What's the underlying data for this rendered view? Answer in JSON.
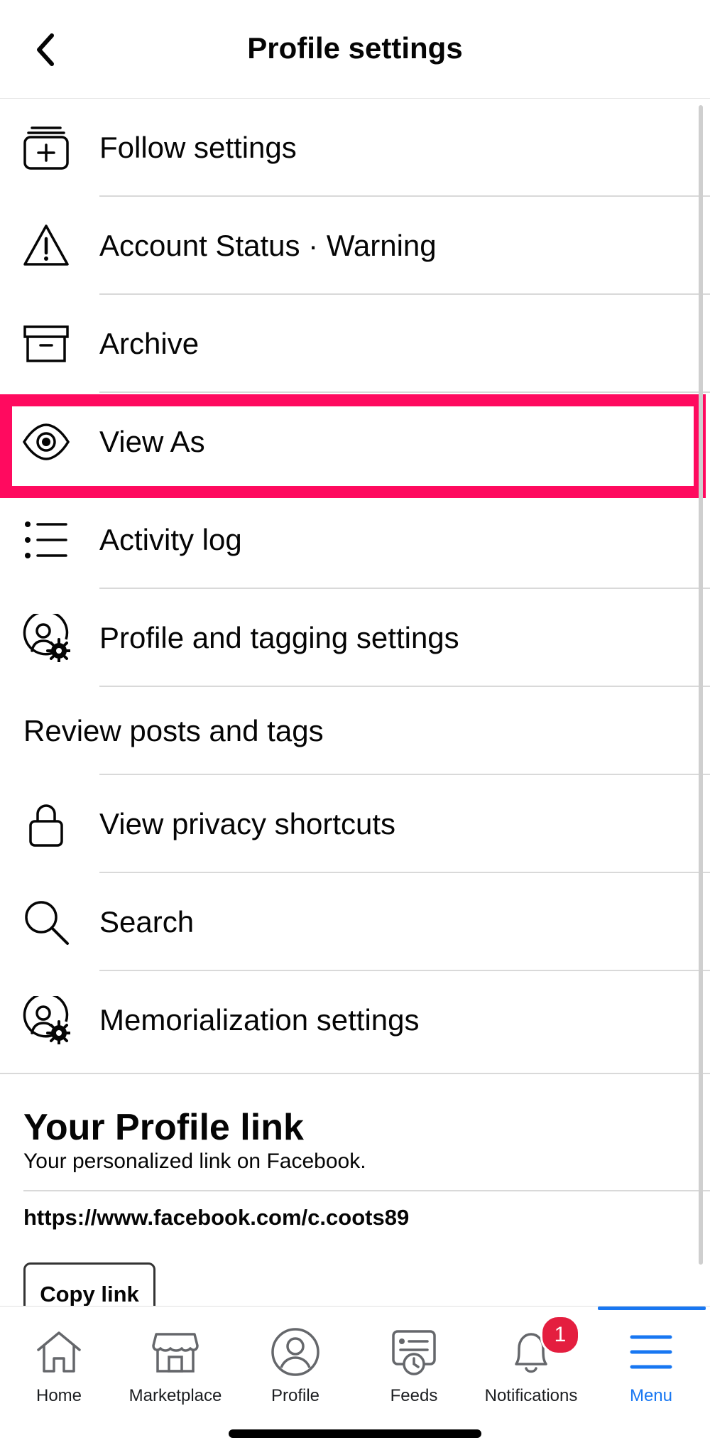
{
  "header": {
    "title": "Profile settings"
  },
  "items": [
    {
      "label": "Follow settings",
      "icon": "follow-settings-icon"
    },
    {
      "label": "Account Status · Warning",
      "icon": "warning-icon"
    },
    {
      "label": "Archive",
      "icon": "archive-icon"
    },
    {
      "label": "View As",
      "icon": "eye-icon"
    },
    {
      "label": "Activity log",
      "icon": "list-icon"
    },
    {
      "label": "Profile and tagging settings",
      "icon": "profile-gear-icon"
    },
    {
      "label": "Review posts and tags",
      "icon": ""
    },
    {
      "label": "View privacy shortcuts",
      "icon": "lock-icon"
    },
    {
      "label": "Search",
      "icon": "search-icon"
    },
    {
      "label": "Memorialization settings",
      "icon": "profile-gear-icon"
    }
  ],
  "profile_link": {
    "title": "Your Profile link",
    "subtitle": "Your personalized link on Facebook.",
    "url": "https://www.facebook.com/c.coots89",
    "copy_label": "Copy link"
  },
  "tabbar": {
    "tabs": [
      {
        "label": "Home",
        "icon": "home-icon"
      },
      {
        "label": "Marketplace",
        "icon": "marketplace-icon"
      },
      {
        "label": "Profile",
        "icon": "profile-icon"
      },
      {
        "label": "Feeds",
        "icon": "feeds-icon"
      },
      {
        "label": "Notifications",
        "icon": "bell-icon",
        "badge": "1"
      },
      {
        "label": "Menu",
        "icon": "menu-icon",
        "active": true
      }
    ]
  },
  "colors": {
    "highlight": "#ff0a5f",
    "accent": "#1877f2",
    "badge": "#e41e3f"
  }
}
